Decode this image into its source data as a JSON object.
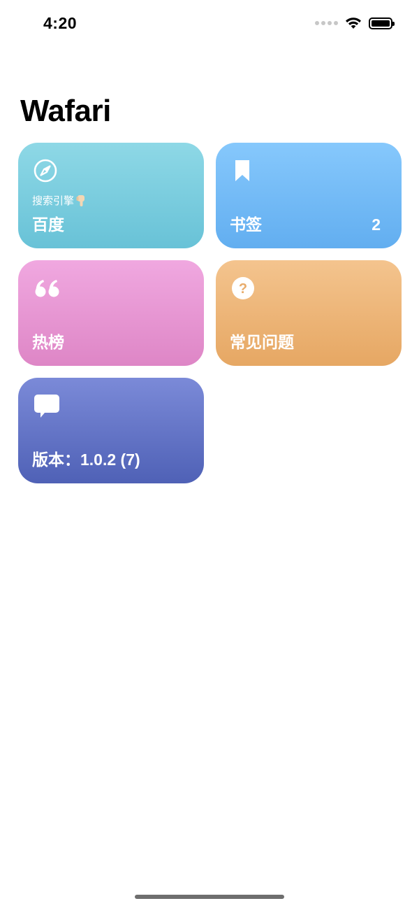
{
  "status_bar": {
    "time": "4:20",
    "icons": [
      "signal-dots-icon",
      "wifi-icon",
      "battery-icon"
    ]
  },
  "header": {
    "title": "Wafari"
  },
  "cards": {
    "search": {
      "icon": "compass-icon",
      "sublabel": "搜索引擎",
      "sublabel_icon": "pointing-down-hand-icon",
      "label": "百度",
      "color": "#7ccfe0"
    },
    "bookmarks": {
      "icon": "bookmark-icon",
      "label": "书签",
      "count": "2",
      "color": "#74bbf6"
    },
    "trending": {
      "icon": "quote-icon",
      "label": "热榜",
      "color": "#e898d3"
    },
    "faq": {
      "icon": "question-circle-icon",
      "label": "常见问题",
      "color": "#edb679"
    },
    "version": {
      "icon": "speech-bubble-icon",
      "label": "版本：1.0.2 (7)",
      "color": "#6576c8"
    }
  }
}
